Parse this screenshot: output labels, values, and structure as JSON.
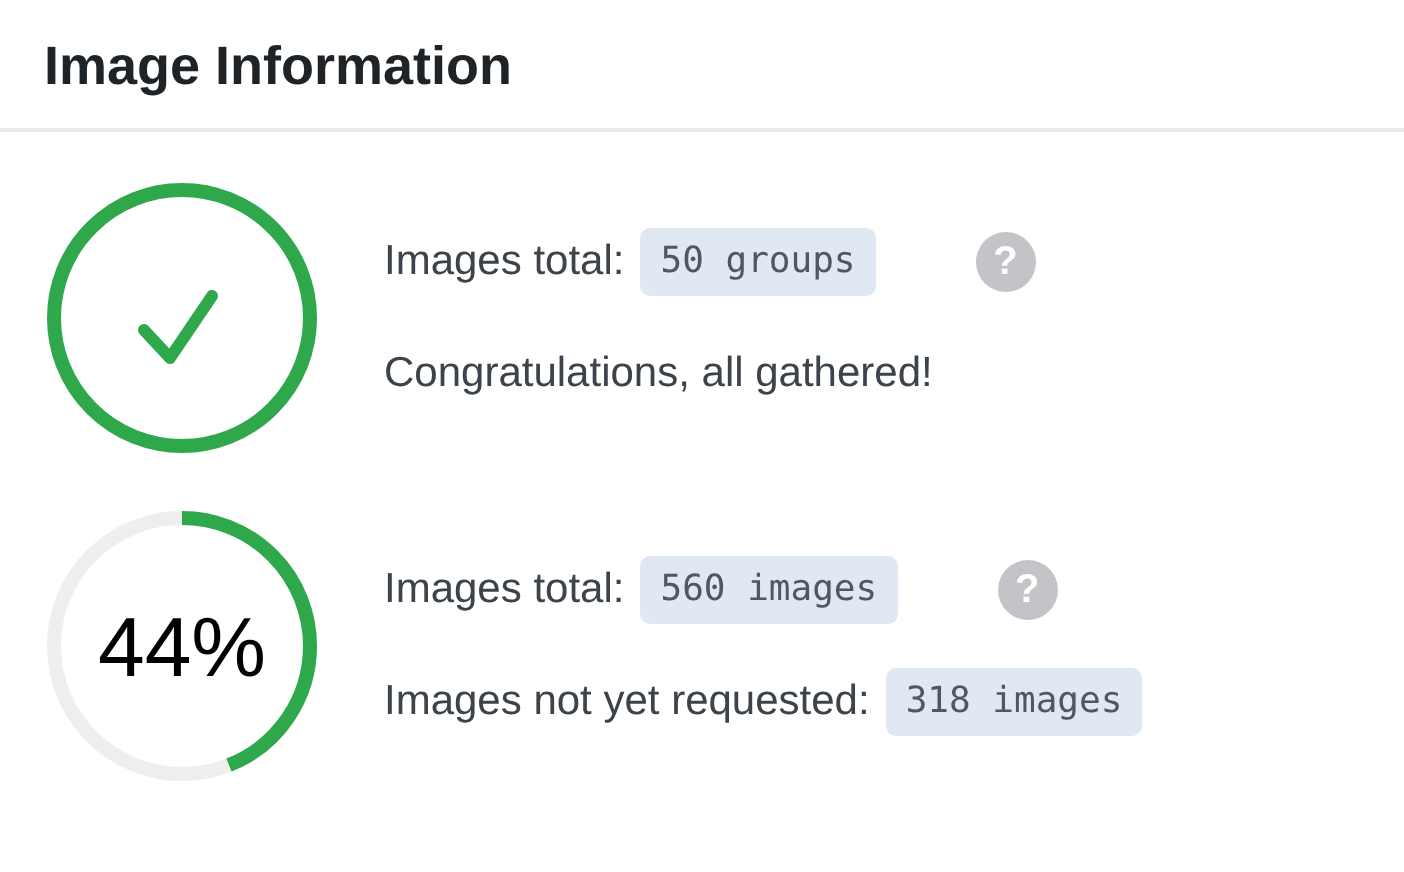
{
  "title": "Image Information",
  "sections": [
    {
      "kind": "complete",
      "lines": [
        {
          "label": "Images total:",
          "value": "50 groups",
          "help": "?"
        },
        {
          "label": "Congratulations, all gathered!"
        }
      ]
    },
    {
      "kind": "progress",
      "level": 0.44,
      "percent": "44%",
      "lines": [
        {
          "label": "Images total:",
          "value": "560 images",
          "help": "?"
        },
        {
          "label": "Images not yet requested:",
          "value": "318 images"
        }
      ]
    }
  ]
}
